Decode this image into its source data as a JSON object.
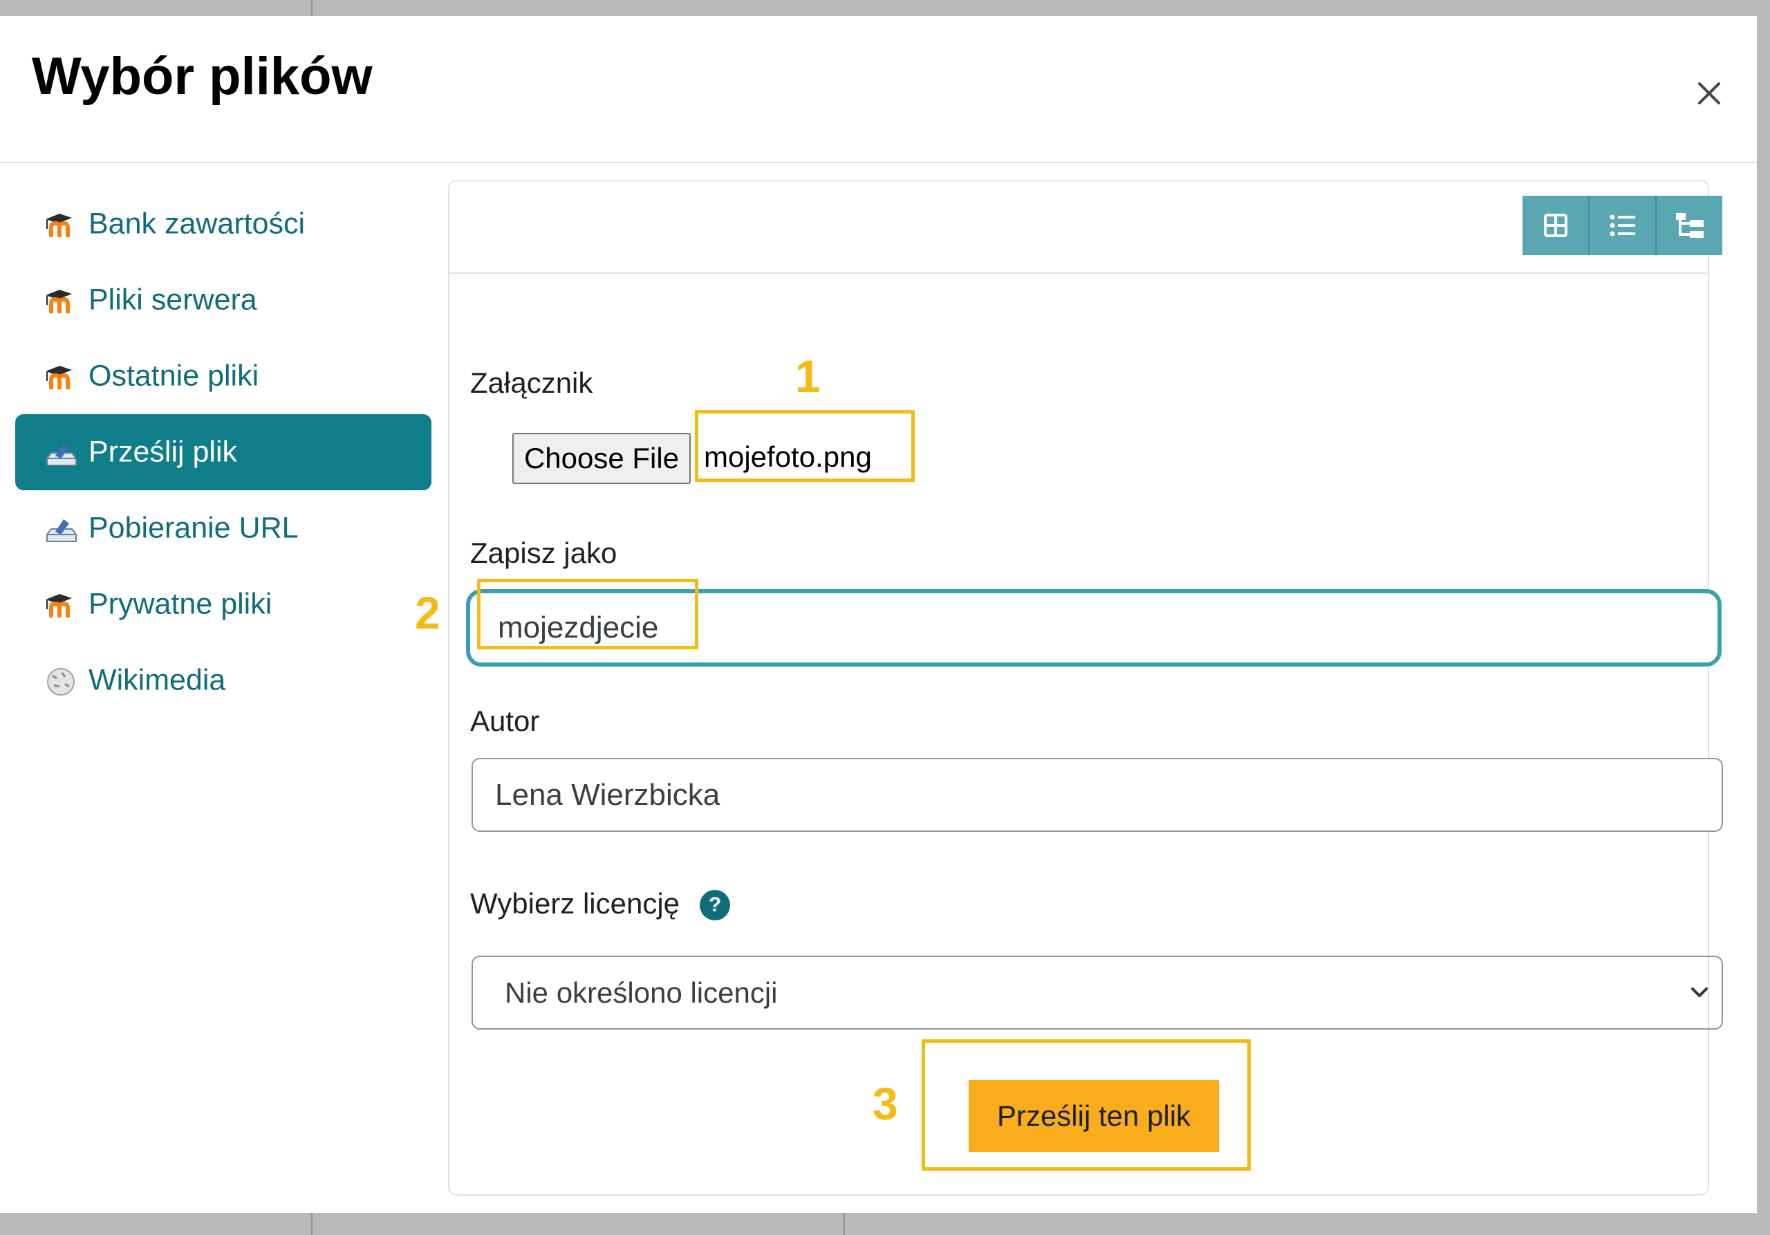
{
  "dialog": {
    "title": "Wybór plików",
    "close_icon": "close-icon"
  },
  "sidebar": {
    "items": [
      {
        "label": "Bank zawartości",
        "icon": "moodle-icon",
        "active": false
      },
      {
        "label": "Pliki serwera",
        "icon": "moodle-icon",
        "active": false
      },
      {
        "label": "Ostatnie pliki",
        "icon": "moodle-icon",
        "active": false
      },
      {
        "label": "Prześlij plik",
        "icon": "upload-icon",
        "active": true
      },
      {
        "label": "Pobieranie URL",
        "icon": "upload-icon",
        "active": false
      },
      {
        "label": "Prywatne pliki",
        "icon": "moodle-icon",
        "active": false
      },
      {
        "label": "Wikimedia",
        "icon": "wikipedia-globe-icon",
        "active": false
      }
    ]
  },
  "toolbar": {
    "view_buttons": [
      "grid-view-icon",
      "list-view-icon",
      "tree-view-icon"
    ]
  },
  "form": {
    "attachment_label": "Załącznik",
    "choose_file_label": "Choose File",
    "file_name": "mojefoto.png",
    "save_as_label": "Zapisz jako",
    "save_as_value": "mojezdjecie",
    "author_label": "Autor",
    "author_value": "Lena Wierzbicka",
    "license_label": "Wybierz licencję",
    "license_help_icon": "?",
    "license_value": "Nie określono licencji",
    "submit_label": "Prześlij ten plik"
  },
  "annotations": {
    "step1": "1",
    "step2": "2",
    "step3": "3",
    "color": "#f3bc15"
  },
  "colors": {
    "accent": "#0f7d8a",
    "link": "#0f6c7a",
    "submit": "#f9ac1c",
    "focus_border": "#39a0b0"
  }
}
